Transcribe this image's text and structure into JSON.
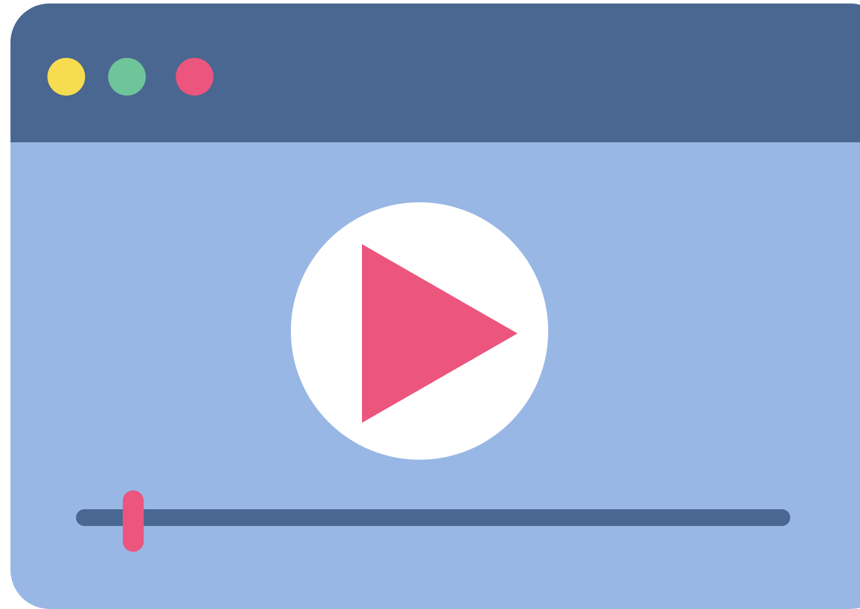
{
  "colors": {
    "titlebar": "#4a6791",
    "content_background": "#99b7e4",
    "dot_yellow": "#f8dc4f",
    "dot_green": "#6fc49a",
    "dot_red": "#ec557d",
    "play_button_background": "#ffffff",
    "play_triangle": "#ec557d",
    "progress_track": "#4a6791",
    "progress_handle": "#ec557d"
  },
  "window_controls": [
    {
      "name": "minimize",
      "color_key": "dot_yellow",
      "icon": "yellow-circle-icon"
    },
    {
      "name": "maximize",
      "color_key": "dot_green",
      "icon": "green-circle-icon"
    },
    {
      "name": "close",
      "color_key": "dot_red",
      "icon": "red-circle-icon"
    }
  ],
  "player": {
    "play_icon": "play-triangle-icon",
    "progress": 0.08
  }
}
